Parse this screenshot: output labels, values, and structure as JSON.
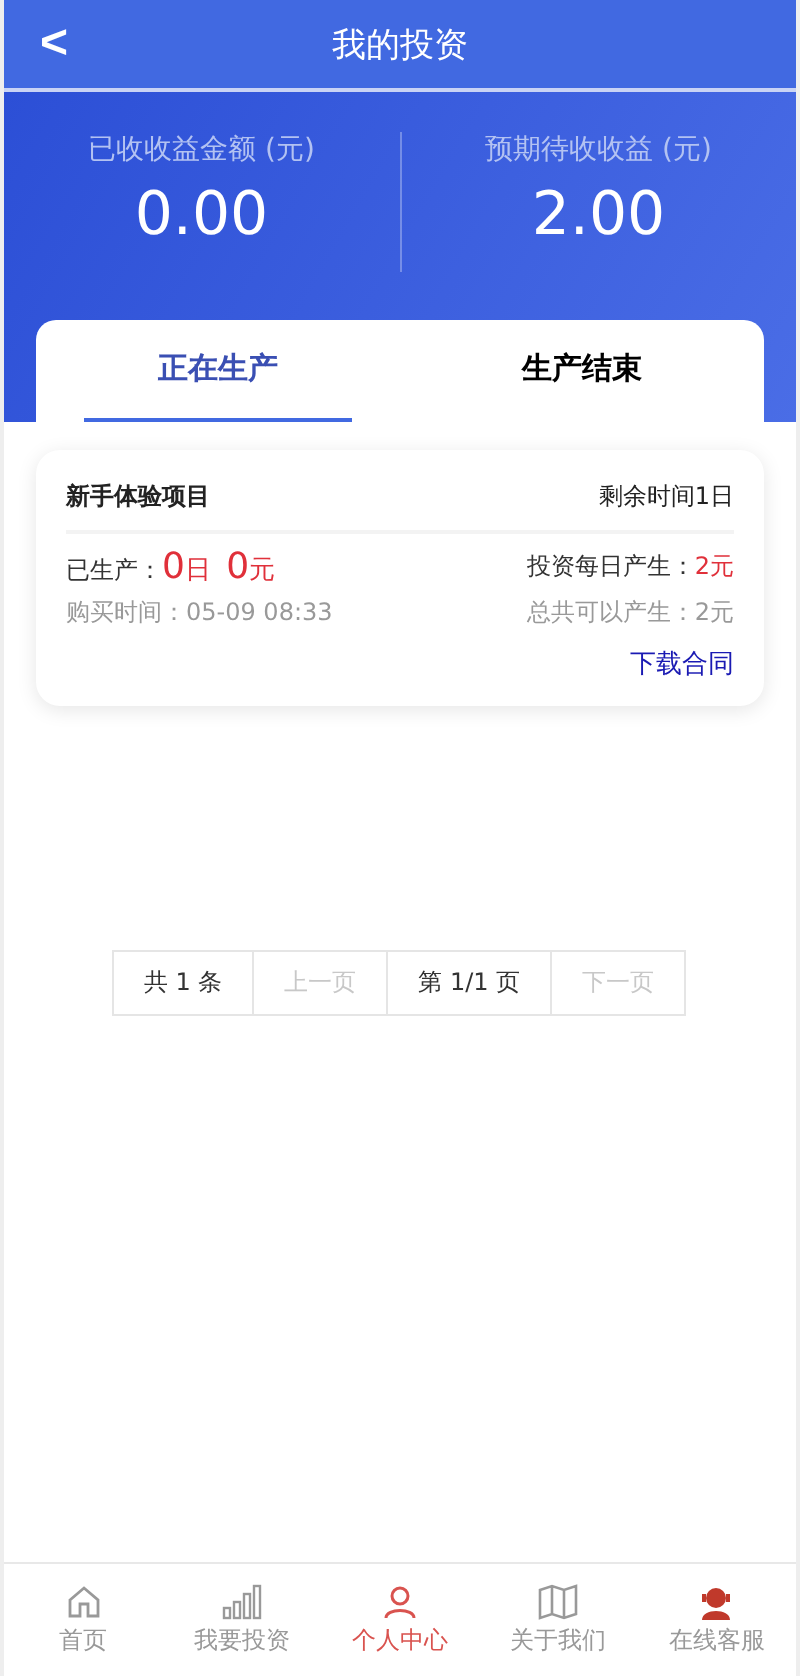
{
  "header": {
    "back": "<",
    "title": "我的投资"
  },
  "summary": [
    {
      "label": "已收收益金额 (元)",
      "value": "0.00"
    },
    {
      "label": "预期待收收益 (元)",
      "value": "2.00"
    }
  ],
  "tabs": [
    {
      "label": "正在生产",
      "selected": true
    },
    {
      "label": "生产结束",
      "selected": false
    }
  ],
  "investments": [
    {
      "name": "新手体验项目",
      "remaining": "剩余时间1日",
      "produced_label": "已生产：",
      "produced_days": "0",
      "days_unit": "日",
      "produced_amount": "0",
      "amount_unit": "元",
      "daily_label": "投资每日产生：",
      "daily_value": "2元",
      "purchase_time": "购买时间：05-09 08:33",
      "total": "总共可以产生：2元",
      "contract_link": "下载合同"
    }
  ],
  "pagination": [
    {
      "label": "共 1 条",
      "disabled": false
    },
    {
      "label": "上一页",
      "disabled": true
    },
    {
      "label": "第 1/1 页",
      "disabled": false
    },
    {
      "label": "下一页",
      "disabled": true
    }
  ],
  "nav": [
    {
      "label": "首页",
      "selected": false
    },
    {
      "label": "我要投资",
      "selected": false
    },
    {
      "label": "个人中心",
      "selected": true
    },
    {
      "label": "关于我们",
      "selected": false
    },
    {
      "label": "在线客服",
      "selected": false
    }
  ]
}
